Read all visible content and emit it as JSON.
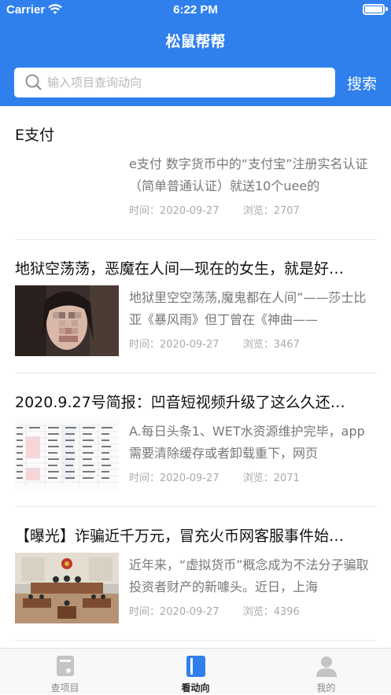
{
  "status_bar": {
    "carrier": "Carrier",
    "time": "6:22 PM"
  },
  "header": {
    "title": "松鼠帮帮"
  },
  "search": {
    "placeholder": "输入项目查询动向",
    "button_label": "搜索"
  },
  "articles": [
    {
      "title": "E支付",
      "excerpt": "e支付 数字货币中的“支付宝”注册实名认证（简单普通认证）就送10个uee的",
      "time_label": "时间：",
      "date": "2020-09-27",
      "views_label": "浏览：",
      "views": "2707",
      "thumbnail": "none"
    },
    {
      "title": "地狱空荡荡，恶魔在人间—现在的女生，就是好…",
      "excerpt": "地狱里空空荡荡,魔鬼都在人间”——莎士比亚《暴风雨》但丁曾在《神曲——",
      "time_label": "时间：",
      "date": "2020-09-27",
      "views_label": "浏览：",
      "views": "3467",
      "thumbnail": "portrait-photo"
    },
    {
      "title": "2020.9.27号简报：凹音短视频升级了这么久还…",
      "excerpt": "A.每日头条1、WET水资源维护完毕，app需要清除缓存或者卸载重下，网页",
      "time_label": "时间：",
      "date": "2020-09-27",
      "views_label": "浏览：",
      "views": "2071",
      "thumbnail": "spreadsheet-image"
    },
    {
      "title": "【曝光】诈骗近千万元，冒充火币网客服事件始…",
      "excerpt": "近年来，“虚拟货币”概念成为不法分子骗取投资者财产的新噱头。近日，上海",
      "time_label": "时间：",
      "date": "2020-09-27",
      "views_label": "浏览：",
      "views": "4396",
      "thumbnail": "courtroom-photo"
    }
  ],
  "tabbar": {
    "tabs": [
      {
        "label": "查项目",
        "icon": "project-icon",
        "active": false
      },
      {
        "label": "看动向",
        "icon": "trends-icon",
        "active": true
      },
      {
        "label": "我的",
        "icon": "profile-icon",
        "active": false
      }
    ]
  },
  "colors": {
    "primary": "#2f80ed",
    "text_muted": "#777777",
    "meta": "#aaaaaa"
  }
}
